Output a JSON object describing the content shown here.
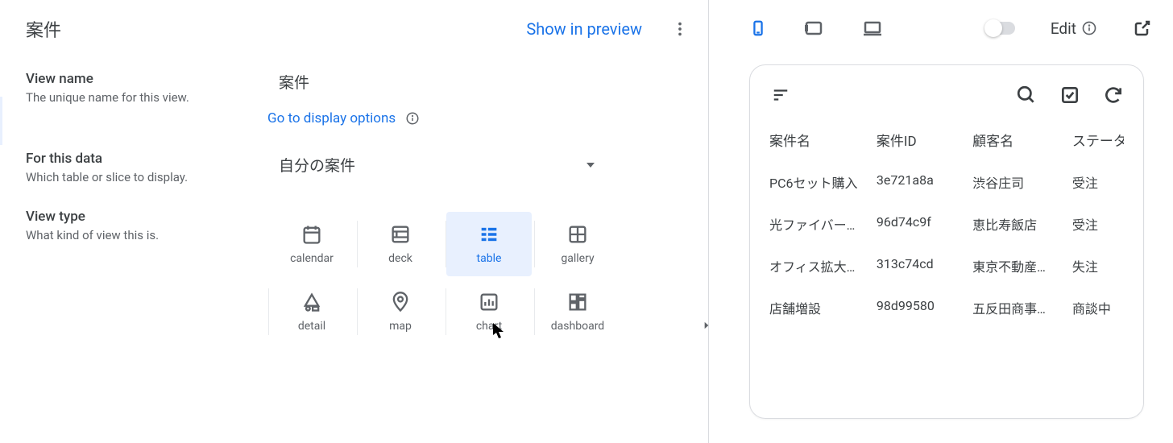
{
  "header": {
    "title": "案件",
    "show_preview": "Show in preview"
  },
  "view_name": {
    "label": "View name",
    "sublabel": "The unique name for this view.",
    "value": "案件",
    "display_link": "Go to display options"
  },
  "for_data": {
    "label": "For this data",
    "sublabel": "Which table or slice to display.",
    "value": "自分の案件"
  },
  "view_type": {
    "label": "View type",
    "sublabel": "What kind of view this is.",
    "types": [
      {
        "key": "calendar",
        "label": "calendar"
      },
      {
        "key": "deck",
        "label": "deck"
      },
      {
        "key": "table",
        "label": "table"
      },
      {
        "key": "gallery",
        "label": "gallery"
      },
      {
        "key": "detail",
        "label": "detail"
      },
      {
        "key": "map",
        "label": "map"
      },
      {
        "key": "chart",
        "label": "chart"
      },
      {
        "key": "dashboard",
        "label": "dashboard"
      }
    ],
    "selected": "table"
  },
  "preview": {
    "edit_label": "Edit",
    "headers": [
      "案件名",
      "案件ID",
      "顧客名",
      "ステータス"
    ],
    "rows": [
      {
        "name": "PC6セット購入",
        "id": "3e721a8a",
        "cust": "渋谷庄司",
        "status": "受注"
      },
      {
        "name": "光ファイバー…",
        "id": "96d74c9f",
        "cust": "恵比寿飯店",
        "status": "受注"
      },
      {
        "name": "オフィス拡大…",
        "id": "313c74cd",
        "cust": "東京不動産…",
        "status": "失注"
      },
      {
        "name": "店舗増設",
        "id": "98d99580",
        "cust": "五反田商事…",
        "status": "商談中"
      }
    ]
  }
}
